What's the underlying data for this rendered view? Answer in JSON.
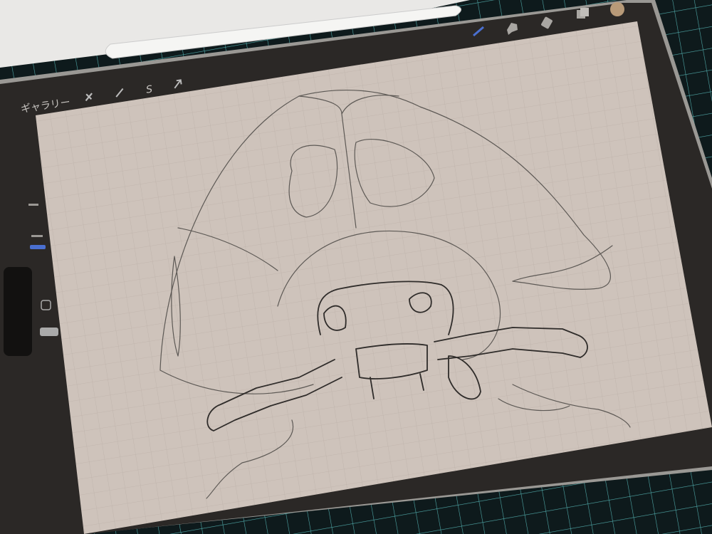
{
  "toolbar": {
    "gallery_label": "ギャラリー",
    "left_icons": [
      "wrench-icon",
      "magic-wand-icon",
      "selection-icon",
      "transform-arrow-icon"
    ],
    "right_icons": [
      "brush-icon",
      "smudge-icon",
      "eraser-icon",
      "layers-icon",
      "color-swatch-icon"
    ],
    "active_tool": "brush",
    "brush_color": "#4a6fd0",
    "swatch_color": "#b89a78"
  },
  "sidebar": {
    "controls": [
      "brush-size-slider",
      "opacity-slider",
      "modify-button",
      "undo-button",
      "redo-button"
    ]
  },
  "canvas": {
    "background": "#cfc4bc",
    "grid": true
  }
}
